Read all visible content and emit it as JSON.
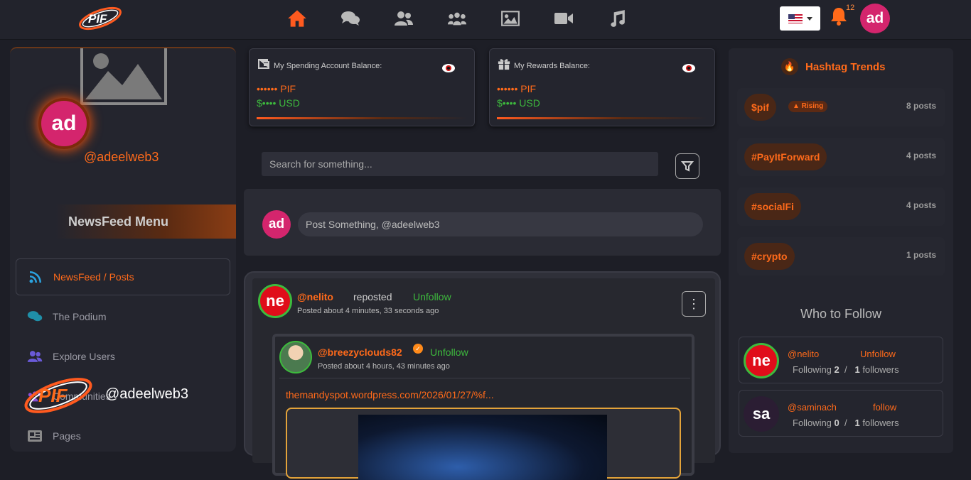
{
  "brand": {
    "logo_text": "PIF",
    "overlay_user": "@adeelweb3"
  },
  "nav": {
    "icons": [
      "home-icon",
      "chat-icon",
      "users-icon",
      "communities-icon",
      "image-icon",
      "video-icon",
      "music-icon"
    ],
    "active": "home-icon"
  },
  "header": {
    "language": "en-US",
    "notification_count": "12",
    "avatar_initials": "ad"
  },
  "profile": {
    "avatar_initials": "ad",
    "handle": "@adeelweb3"
  },
  "menu": {
    "title": "NewsFeed Menu",
    "items": [
      {
        "label": "NewsFeed / Posts",
        "icon": "rss-icon",
        "active": true
      },
      {
        "label": "The Podium",
        "icon": "chat-icon"
      },
      {
        "label": "Explore Users",
        "icon": "users-icon"
      },
      {
        "label": "Communities",
        "icon": "communities-icon"
      },
      {
        "label": "Pages",
        "icon": "newspaper-icon"
      }
    ]
  },
  "balances": [
    {
      "title": "My Spending Account Balance:",
      "pif": "•••••• PIF",
      "usd": "$•••• USD",
      "icon": "wallet-icon"
    },
    {
      "title": "My Rewards Balance:",
      "pif": "•••••• PIF",
      "usd": "$•••• USD",
      "icon": "gift-icon"
    }
  ],
  "search": {
    "placeholder": "Search for something..."
  },
  "composer": {
    "avatar_initials": "ad",
    "placeholder": "Post Something, @adeelweb3"
  },
  "post": {
    "avatar_initials": "ne",
    "user": "@nelito",
    "action": "reposted",
    "follow_label": "Unfollow",
    "time": "Posted about 4 minutes, 33 seconds ago",
    "repost": {
      "user": "@breezyclouds82",
      "follow_label": "Unfollow",
      "time": "Posted about 4 hours, 43 minutes ago",
      "link": "themandyspot.wordpress.com/2026/01/27/%f..."
    }
  },
  "trends": {
    "title": "Hashtag Trends",
    "items": [
      {
        "tag": "$pif",
        "badge": "▲ Rising",
        "count": "8 posts"
      },
      {
        "tag": "#PayItForward",
        "count": "4 posts"
      },
      {
        "tag": "#socialFi",
        "count": "4 posts"
      },
      {
        "tag": "#crypto",
        "count": "1 posts"
      }
    ]
  },
  "who_to_follow": {
    "title": "Who to Follow",
    "users": [
      {
        "initials": "ne",
        "user": "@nelito",
        "action": "Unfollow",
        "following": "2",
        "followers": "1",
        "following_label": "Following",
        "followers_label": "followers",
        "color": "#e00d1a"
      },
      {
        "initials": "sa",
        "user": "@saminach",
        "action": "follow",
        "following": "0",
        "followers": "1",
        "following_label": "Following",
        "followers_label": "followers",
        "color": "#2b1d33"
      }
    ]
  }
}
